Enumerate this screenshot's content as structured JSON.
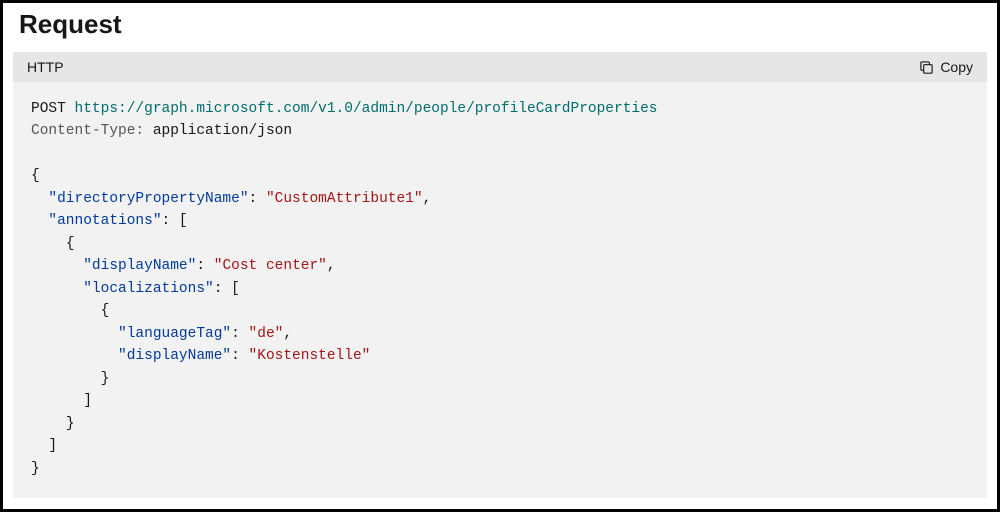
{
  "heading": "Request",
  "codebar": {
    "language": "HTTP",
    "copy_label": "Copy"
  },
  "request": {
    "method": "POST",
    "url": "https://graph.microsoft.com/v1.0/admin/people/profileCardProperties",
    "header_name": "Content-Type:",
    "header_value": "application/json"
  },
  "body": {
    "k_dirProp": "\"directoryPropertyName\"",
    "v_dirProp": "\"CustomAttribute1\"",
    "k_annotations": "\"annotations\"",
    "k_displayName1": "\"displayName\"",
    "v_displayName1": "\"Cost center\"",
    "k_localizations": "\"localizations\"",
    "k_languageTag": "\"languageTag\"",
    "v_languageTag": "\"de\"",
    "k_displayName2": "\"displayName\"",
    "v_displayName2": "\"Kostenstelle\""
  }
}
